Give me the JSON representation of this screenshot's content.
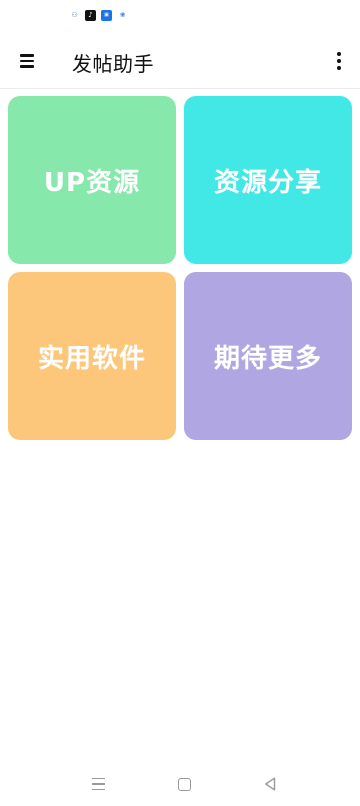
{
  "status_bar": {
    "icons": [
      "app-icon-1",
      "douyin-icon",
      "app-icon-3",
      "baidu-icon"
    ]
  },
  "app_bar": {
    "title": "发帖助手",
    "menu_icon": "hamburger-menu-icon",
    "more_icon": "more-vertical-icon"
  },
  "tiles": [
    {
      "label": "UP资源",
      "color": "#86e8aa"
    },
    {
      "label": "资源分享",
      "color": "#42e8e6"
    },
    {
      "label": "实用软件",
      "color": "#fcc77a"
    },
    {
      "label": "期待更多",
      "color": "#b0a6e2"
    }
  ],
  "nav_bar": {
    "icons": [
      "recent-apps-icon",
      "home-icon",
      "back-icon"
    ],
    "color": "#9a9a9a"
  }
}
